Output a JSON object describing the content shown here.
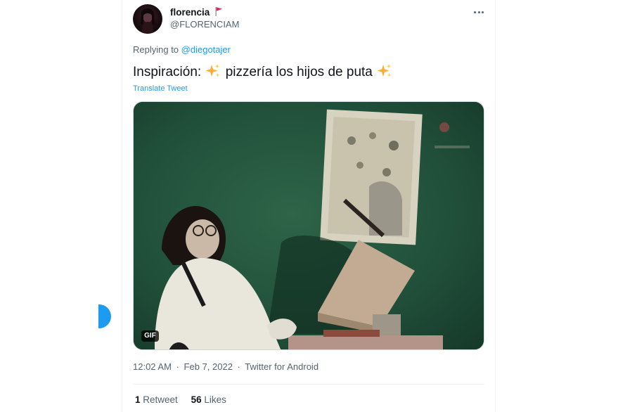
{
  "tweet": {
    "author": {
      "display_name": "florencia",
      "handle": "@FLORENCIAM",
      "name_emoji": "red-flag-icon"
    },
    "reply_to": {
      "prefix": "Replying to",
      "handle": "@diegotajer"
    },
    "text": {
      "part1": "Inspiración: ",
      "part2": " pizzería los hijos de puta ",
      "emoji": "sparkles-icon"
    },
    "translate_label": "Translate Tweet",
    "media": {
      "type": "gif",
      "badge": "GIF"
    },
    "meta": {
      "time": "12:02 AM",
      "date": "Feb 7, 2022",
      "source": "Twitter for Android",
      "separator": "·"
    },
    "stats": {
      "retweets_count": "1",
      "retweets_label": "Retweet",
      "likes_count": "56",
      "likes_label": "Likes"
    }
  },
  "colors": {
    "accent": "#1d9bf0",
    "secondary_text": "#536471",
    "primary_text": "#0f1419",
    "border": "#eff3f4"
  }
}
